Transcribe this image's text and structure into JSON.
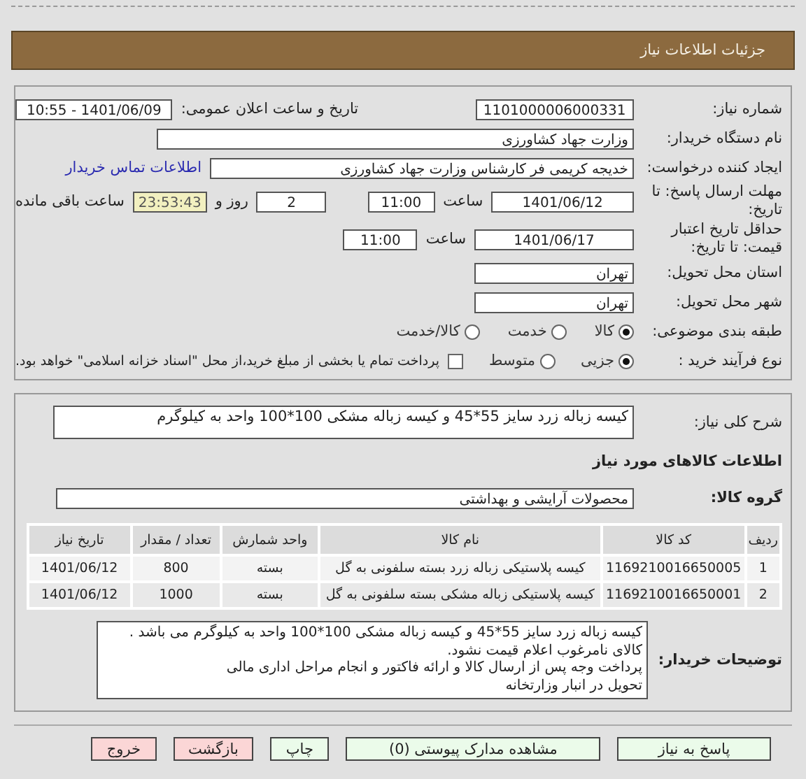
{
  "header": {
    "title": "جزئیات اطلاعات نیاز"
  },
  "request": {
    "need_number": {
      "label": "شماره نیاز:",
      "value": "1101000006000331"
    },
    "announce_date": {
      "label": "تاریخ و ساعت اعلان عمومی:",
      "value": "1401/06/09 - 10:55"
    },
    "buyer_org": {
      "label": "نام دستگاه خریدار:",
      "value": "وزارت جهاد کشاورزی"
    },
    "creator": {
      "label": "ایجاد کننده درخواست:",
      "value": "خدیجه کریمی فر کارشناس وزارت جهاد کشاورزی",
      "link": "اطلاعات تماس خریدار"
    },
    "reply_deadline": {
      "label": "مهلت ارسال پاسخ: تا تاریخ:",
      "date": "1401/06/12",
      "time_label": "ساعت",
      "time": "11:00",
      "days": "2",
      "days_label": "روز و",
      "remaining": "23:53:43",
      "remaining_label": "ساعت باقی مانده"
    },
    "price_validity": {
      "label": "حداقل تاریخ اعتبار قیمت: تا تاریخ:",
      "date": "1401/06/17",
      "time_label": "ساعت",
      "time": "11:00"
    },
    "province": {
      "label": "استان محل تحویل:",
      "value": "تهران"
    },
    "city": {
      "label": "شهر محل تحویل:",
      "value": "تهران"
    },
    "category": {
      "label": "طبقه بندی موضوعی:",
      "options": [
        {
          "label": "کالا",
          "selected": true
        },
        {
          "label": "خدمت",
          "selected": false
        },
        {
          "label": "کالا/خدمت",
          "selected": false
        }
      ]
    },
    "process": {
      "label": "نوع فرآیند خرید :",
      "options": [
        {
          "label": "جزیی",
          "selected": true
        },
        {
          "label": "متوسط",
          "selected": false
        }
      ],
      "payment": {
        "label": "پرداخت تمام یا بخشی از مبلغ خرید،از محل \"اسناد خزانه اسلامی\" خواهد بود.",
        "checked": false
      }
    }
  },
  "goods": {
    "summary": {
      "label": "شرح کلی نیاز:",
      "value": "کیسه زباله زرد سایز 55*45 و کیسه زباله مشکی 100*100 واحد به کیلوگرم"
    },
    "section_title": "اطلاعات کالاهای مورد نیاز",
    "group": {
      "label": "گروه کالا:",
      "value": "محصولات آرایشی و بهداشتی"
    },
    "table": {
      "columns": [
        "ردیف",
        "کد کالا",
        "نام کالا",
        "واحد شمارش",
        "تعداد / مقدار",
        "تاریخ نیاز"
      ],
      "rows": [
        [
          "1",
          "1169210016650005",
          "کیسه پلاستیکی زباله زرد بسته سلفونی به گل",
          "بسته",
          "800",
          "1401/06/12"
        ],
        [
          "2",
          "1169210016650001",
          "کیسه پلاستیکی زباله مشکی بسته سلفونی به گل",
          "بسته",
          "1000",
          "1401/06/12"
        ]
      ]
    },
    "buyer_notes": {
      "label": "توضیحات خریدار:",
      "value": "کیسه زباله زرد سایز 55*45 و کیسه زباله مشکی 100*100 واحد به کیلوگرم می باشد . کالای نامرغوب اعلام قیمت نشود.\nپرداخت وجه پس از ارسال کالا و ارائه فاکتور و انجام مراحل اداری مالی\nتحویل در انبار وزارتخانه"
    }
  },
  "buttons": [
    {
      "label": "پاسخ به نیاز",
      "kind": "normal"
    },
    {
      "label": "مشاهده مدارک پیوستی (0)",
      "kind": "normal"
    },
    {
      "label": "چاپ",
      "kind": "normal"
    },
    {
      "label": "بازگشت",
      "kind": "danger"
    },
    {
      "label": "خروج",
      "kind": "danger"
    }
  ]
}
